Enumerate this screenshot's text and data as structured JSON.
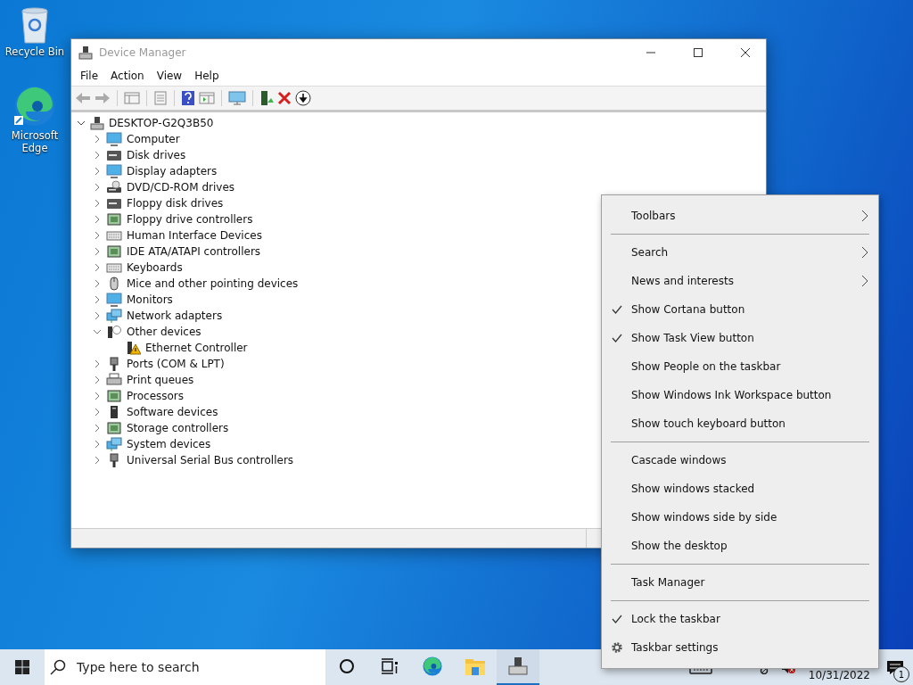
{
  "desktop_icons": [
    {
      "label": "Recycle Bin",
      "kind": "bin"
    },
    {
      "label": "Microsoft Edge",
      "kind": "edge"
    }
  ],
  "window": {
    "title": "Device Manager",
    "active": false
  },
  "menu_bar": [
    "File",
    "Action",
    "View",
    "Help"
  ],
  "tree": {
    "label": "DESKTOP-G2Q3B50",
    "expanded": true,
    "children": [
      {
        "label": "Computer",
        "expanded": false
      },
      {
        "label": "Disk drives",
        "expanded": false
      },
      {
        "label": "Display adapters",
        "expanded": false
      },
      {
        "label": "DVD/CD-ROM drives",
        "expanded": false
      },
      {
        "label": "Floppy disk drives",
        "expanded": false
      },
      {
        "label": "Floppy drive controllers",
        "expanded": false
      },
      {
        "label": "Human Interface Devices",
        "expanded": false
      },
      {
        "label": "IDE ATA/ATAPI controllers",
        "expanded": false
      },
      {
        "label": "Keyboards",
        "expanded": false
      },
      {
        "label": "Mice and other pointing devices",
        "expanded": false
      },
      {
        "label": "Monitors",
        "expanded": false
      },
      {
        "label": "Network adapters",
        "expanded": false
      },
      {
        "label": "Other devices",
        "expanded": true,
        "children": [
          {
            "label": "Ethernet Controller",
            "warning": true
          }
        ]
      },
      {
        "label": "Ports (COM & LPT)",
        "expanded": false
      },
      {
        "label": "Print queues",
        "expanded": false
      },
      {
        "label": "Processors",
        "expanded": false
      },
      {
        "label": "Software devices",
        "expanded": false
      },
      {
        "label": "Storage controllers",
        "expanded": false
      },
      {
        "label": "System devices",
        "expanded": false
      },
      {
        "label": "Universal Serial Bus controllers",
        "expanded": false
      }
    ]
  },
  "context_menu": [
    {
      "kind": "item",
      "label": "Toolbars",
      "checked": false,
      "submenu": true
    },
    {
      "kind": "separator"
    },
    {
      "kind": "item",
      "label": "Search",
      "checked": false,
      "submenu": true
    },
    {
      "kind": "item",
      "label": "News and interests",
      "checked": false,
      "submenu": true
    },
    {
      "kind": "item",
      "label": "Show Cortana button",
      "checked": true,
      "submenu": false
    },
    {
      "kind": "item",
      "label": "Show Task View button",
      "checked": true,
      "submenu": false
    },
    {
      "kind": "item",
      "label": "Show People on the taskbar",
      "checked": false,
      "submenu": false
    },
    {
      "kind": "item",
      "label": "Show Windows Ink Workspace button",
      "checked": false,
      "submenu": false
    },
    {
      "kind": "item",
      "label": "Show touch keyboard button",
      "checked": false,
      "submenu": false
    },
    {
      "kind": "separator"
    },
    {
      "kind": "item",
      "label": "Cascade windows",
      "checked": false,
      "submenu": false
    },
    {
      "kind": "item",
      "label": "Show windows stacked",
      "checked": false,
      "submenu": false
    },
    {
      "kind": "item",
      "label": "Show windows side by side",
      "checked": false,
      "submenu": false
    },
    {
      "kind": "item",
      "label": "Show the desktop",
      "checked": false,
      "submenu": false
    },
    {
      "kind": "separator"
    },
    {
      "kind": "item",
      "label": "Task Manager",
      "checked": false,
      "submenu": false
    },
    {
      "kind": "separator"
    },
    {
      "kind": "item",
      "label": "Lock the taskbar",
      "checked": true,
      "submenu": false
    },
    {
      "kind": "settings",
      "label": "Taskbar settings"
    }
  ],
  "taskbar": {
    "search": {
      "placeholder": "Type here to search"
    },
    "apps": [
      {
        "kind": "cortana",
        "selected": false
      },
      {
        "kind": "taskview",
        "selected": false
      },
      {
        "kind": "edge",
        "selected": false
      },
      {
        "kind": "explorer",
        "selected": false
      },
      {
        "kind": "devmgr",
        "selected": true
      }
    ],
    "date": "10/31/2022",
    "notifications": "1"
  }
}
